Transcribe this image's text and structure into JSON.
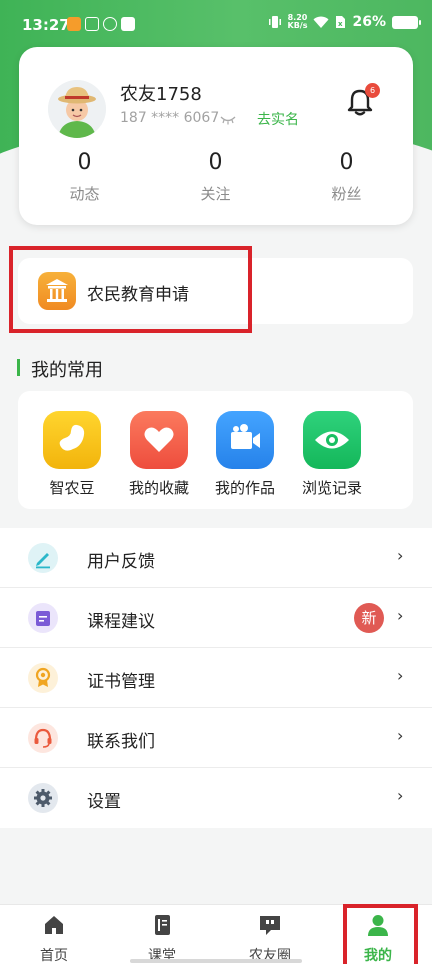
{
  "status_bar": {
    "time": "13:27",
    "net_speed_value": "8.20",
    "net_speed_unit": "KB/s",
    "battery": "26%"
  },
  "profile": {
    "name": "农友1758",
    "phone": "187 **** 6067",
    "verify_label": "去实名",
    "notification_count": "6",
    "stats": [
      {
        "value": "0",
        "label": "动态"
      },
      {
        "value": "0",
        "label": "关注"
      },
      {
        "value": "0",
        "label": "粉丝"
      }
    ]
  },
  "apply": {
    "label": "农民教育申请"
  },
  "common": {
    "title": "我的常用",
    "items": [
      {
        "label": "智农豆",
        "icon": "bean-icon",
        "color": "#f7c51c"
      },
      {
        "label": "我的收藏",
        "icon": "heart-icon",
        "color": "#f4634a"
      },
      {
        "label": "我的作品",
        "icon": "video-camera-icon",
        "color": "#2f8ff3"
      },
      {
        "label": "浏览记录",
        "icon": "eye-icon",
        "color": "#22c46a"
      }
    ]
  },
  "menu": {
    "items": [
      {
        "label": "用户反馈",
        "icon": "pen-icon",
        "color": "#2bb7c9"
      },
      {
        "label": "课程建议",
        "icon": "note-icon",
        "color": "#7b5bd6",
        "badge": "新"
      },
      {
        "label": "证书管理",
        "icon": "medal-icon",
        "color": "#f0a521"
      },
      {
        "label": "联系我们",
        "icon": "headset-icon",
        "color": "#ea5a3d"
      },
      {
        "label": "设置",
        "icon": "gear-icon",
        "color": "#4d5a6a"
      }
    ],
    "chevron": "›"
  },
  "tabs": [
    {
      "label": "首页",
      "icon": "home-icon"
    },
    {
      "label": "课堂",
      "icon": "book-icon"
    },
    {
      "label": "农友圈",
      "icon": "chat-quote-icon"
    },
    {
      "label": "我的",
      "icon": "user-icon",
      "active": true
    }
  ],
  "colors": {
    "brand_green": "#3bb54a",
    "highlight_red": "#d9232a"
  }
}
